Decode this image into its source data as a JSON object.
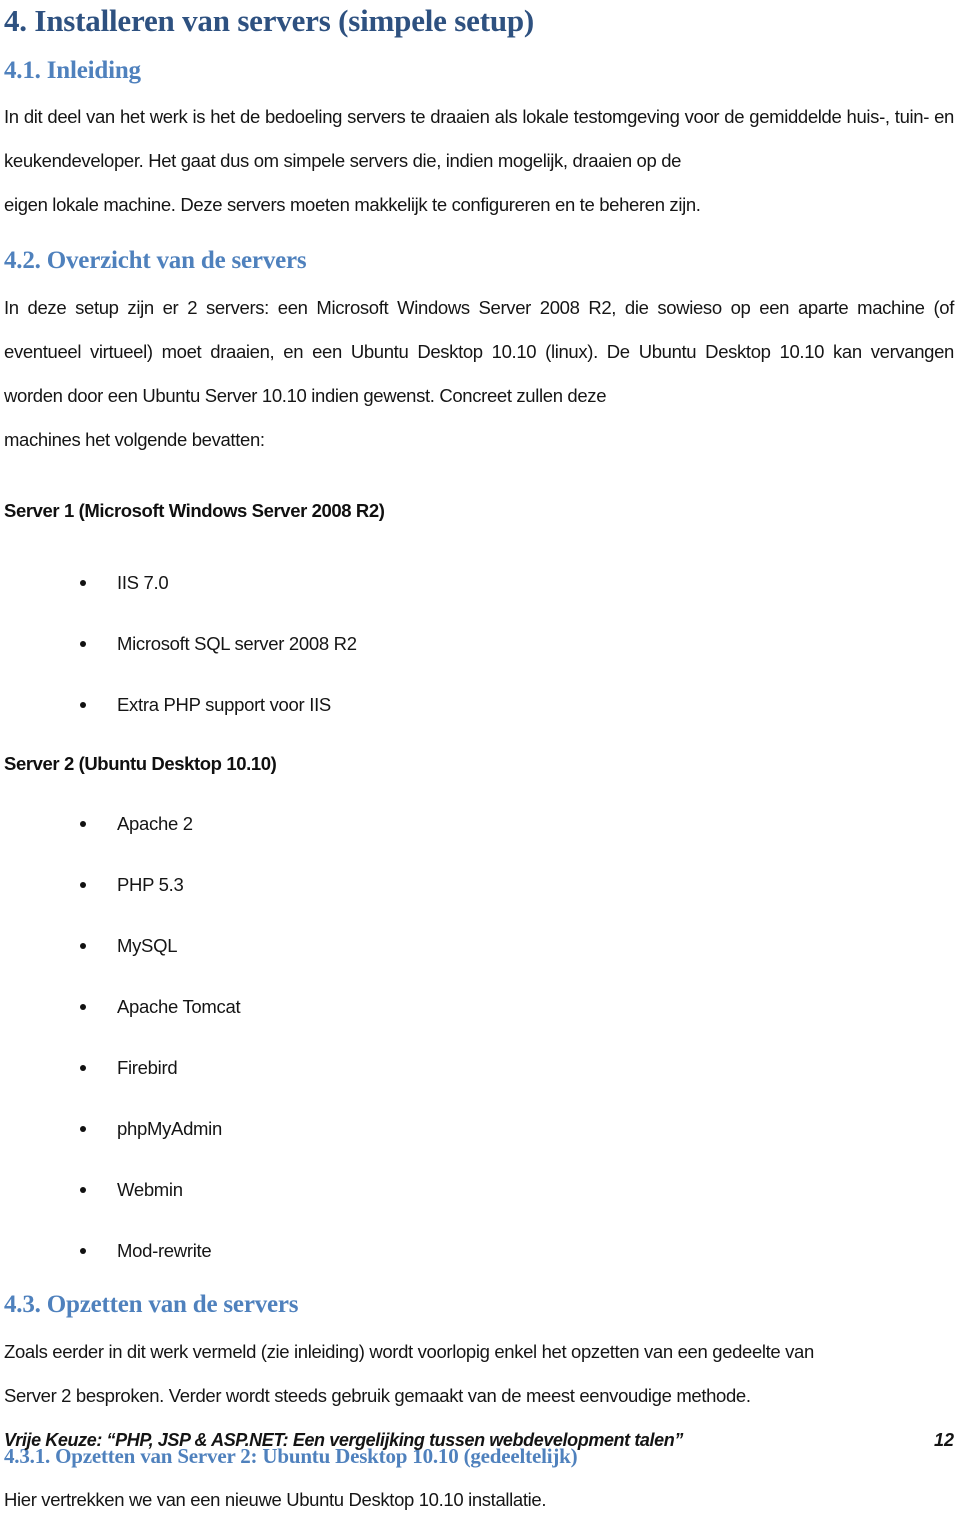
{
  "document": {
    "chapter_title": "4. Installeren van servers (simpele setup)",
    "sections": {
      "intro": {
        "heading": "4.1. Inleiding",
        "paragraph_line1": "In dit deel van het werk is het de bedoeling servers te draaien als lokale testomgeving voor de gemiddelde",
        "paragraph_line2": "huis-, tuin- en keukendeveloper. Het gaat dus om simpele servers die, indien mogelijk, draaien op de",
        "paragraph_line3": "eigen lokale machine. Deze servers moeten makkelijk te configureren en te beheren zijn."
      },
      "overview": {
        "heading": "4.2. Overzicht van de servers",
        "paragraph_line1": "In deze setup zijn er 2 servers: een Microsoft Windows Server 2008 R2, die sowieso op een aparte",
        "paragraph_line2": "machine (of eventueel virtueel) moet draaien, en een Ubuntu Desktop 10.10 (linux). De Ubuntu Desktop",
        "paragraph_line3": "10.10 kan vervangen worden door een Ubuntu Server 10.10 indien gewenst. Concreet zullen deze",
        "paragraph_line4": "machines het volgende bevatten:"
      },
      "server1": {
        "heading": "Server 1 (Microsoft Windows Server 2008 R2)",
        "items": [
          "IIS 7.0",
          "Microsoft SQL server 2008 R2",
          "Extra PHP support voor IIS"
        ]
      },
      "server2": {
        "heading": "Server 2 (Ubuntu Desktop 10.10)",
        "items": [
          "Apache 2",
          "PHP 5.3",
          "MySQL",
          "Apache Tomcat",
          "Firebird",
          "phpMyAdmin",
          "Webmin",
          "Mod-rewrite"
        ]
      },
      "setup": {
        "heading": "4.3. Opzetten van de servers",
        "paragraph_line1": "Zoals eerder in dit werk vermeld (zie inleiding) wordt voorlopig enkel het opzetten van een gedeelte van",
        "paragraph_line2": "Server 2 besproken. Verder wordt steeds gebruik gemaakt van de meest eenvoudige methode."
      },
      "setup_server2": {
        "heading": "4.3.1. Opzetten van Server 2: Ubuntu Desktop 10.10 (gedeeltelijk)",
        "paragraph_line1": "Hier vertrekken we van een nieuwe Ubuntu Desktop 10.10 installatie."
      }
    },
    "footer": {
      "title": "Vrije Keuze: “PHP, JSP & ASP.NET: Een vergelijking tussen webdevelopment talen”",
      "page_number": "12"
    },
    "colors": {
      "heading_primary": "#2e5180",
      "heading_secondary": "#4f81bd",
      "body_text": "#151515"
    }
  }
}
